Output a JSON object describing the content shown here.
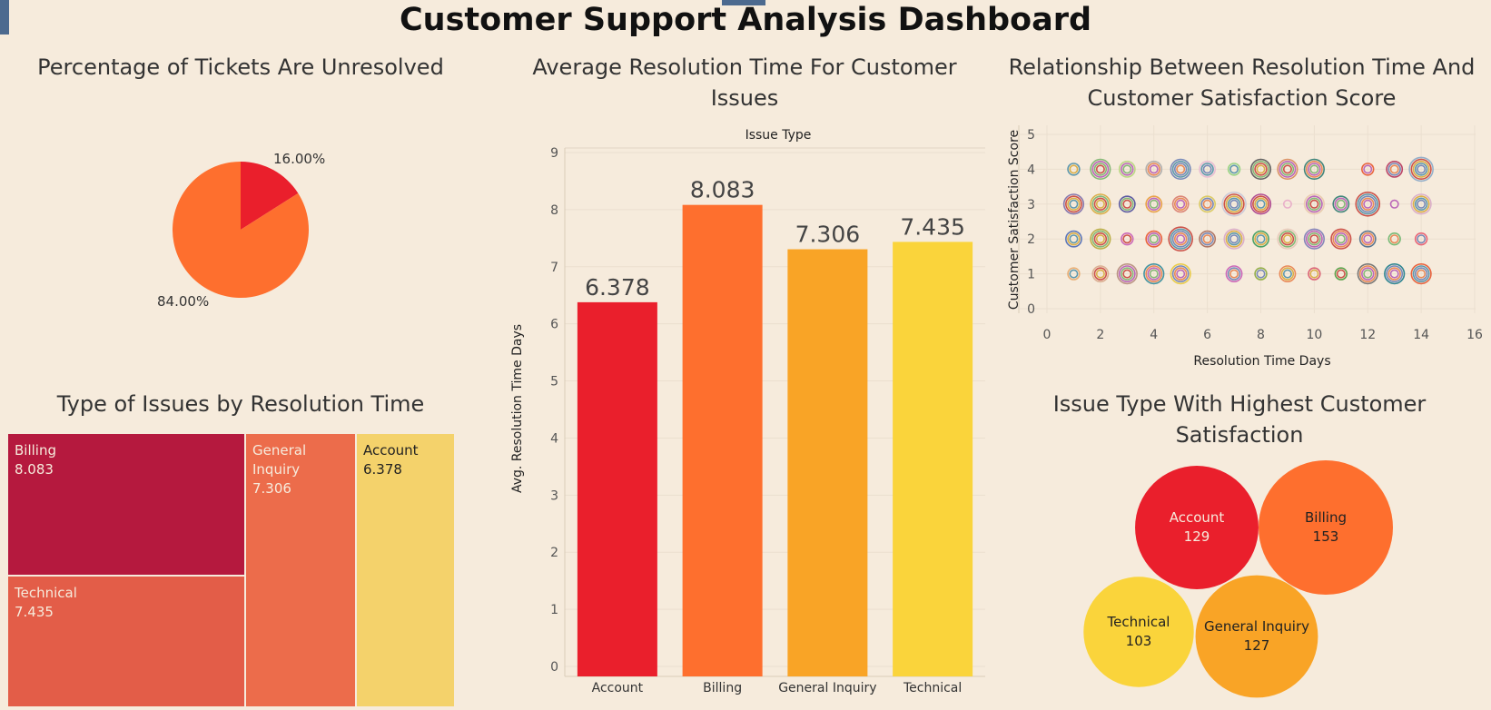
{
  "dashboard": {
    "title": "Customer Support Analysis Dashboard"
  },
  "colors": {
    "background": "#f6ebdc",
    "red": "#ea1f2c",
    "orange": "#fe6f2e",
    "amber": "#f9a426",
    "yellow": "#fad43b",
    "treemap_billing": "#b5193e",
    "treemap_technical": "#e35d48",
    "treemap_general": "#ec6c4b",
    "treemap_account": "#f4d26b"
  },
  "chart_data": [
    {
      "id": "pie",
      "type": "pie",
      "title": "Percentage of Tickets Are Unresolved",
      "slices": [
        {
          "label": "16.00%",
          "value": 16.0,
          "color": "#ea1f2c"
        },
        {
          "label": "84.00%",
          "value": 84.0,
          "color": "#fe6f2e"
        }
      ]
    },
    {
      "id": "bar",
      "type": "bar",
      "title": "Average Resolution Time For Customer Issues",
      "header": "Issue Type",
      "categories": [
        "Account",
        "Billing",
        "General Inquiry",
        "Technical"
      ],
      "values": [
        6.378,
        8.083,
        7.306,
        7.435
      ],
      "value_labels": [
        "6.378",
        "8.083",
        "7.306",
        "7.435"
      ],
      "colors": [
        "#ea1f2c",
        "#fe6f2e",
        "#f9a426",
        "#fad43b"
      ],
      "ylabel": "Avg. Resolution Time Days",
      "yticks": [
        "0",
        "1",
        "2",
        "3",
        "4",
        "5",
        "6",
        "7",
        "8",
        "9"
      ],
      "ylim": [
        0,
        9.15
      ]
    },
    {
      "id": "scatter",
      "type": "scatter",
      "title": "Relationship Between Resolution Time And Customer Satisfaction Score",
      "xlabel": "Resolution Time Days",
      "ylabel": "Customer Satisfaction Score",
      "xticks": [
        "0",
        "2",
        "4",
        "6",
        "8",
        "10",
        "12",
        "14",
        "16"
      ],
      "yticks": [
        "0",
        "1",
        "2",
        "3",
        "4",
        "5"
      ],
      "xlim": [
        0,
        16
      ],
      "ylim": [
        0,
        5.2
      ],
      "grid": true,
      "points": [
        [
          1,
          4,
          "#4e8fa8",
          2
        ],
        [
          2,
          4,
          "#7ab36b",
          4
        ],
        [
          3,
          4,
          "#b5d67a",
          3
        ],
        [
          4,
          4,
          "#a9a9a9",
          3
        ],
        [
          5,
          4,
          "#6a7fb5",
          4
        ],
        [
          6,
          4,
          "#e8b8d2",
          3
        ],
        [
          7,
          4,
          "#8fd17a",
          2
        ],
        [
          8,
          4,
          "#555555",
          4
        ],
        [
          9,
          4,
          "#d88a5a",
          4
        ],
        [
          10,
          4,
          "#2d7a70",
          4
        ],
        [
          12,
          4,
          "#e8552e",
          2
        ],
        [
          13,
          4,
          "#b5325a",
          3
        ],
        [
          14,
          4,
          "#8aa8c8",
          5
        ],
        [
          1,
          3,
          "#7a6aa8",
          4
        ],
        [
          2,
          3,
          "#d8a838",
          4
        ],
        [
          3,
          3,
          "#4b4b9a",
          3
        ],
        [
          4,
          3,
          "#e89a38",
          3
        ],
        [
          5,
          3,
          "#d87a6a",
          3
        ],
        [
          6,
          3,
          "#d8c858",
          3
        ],
        [
          7,
          3,
          "#c8c8d8",
          5
        ],
        [
          8,
          3,
          "#a83a8a",
          4
        ],
        [
          9,
          3,
          "#e8a8c8",
          1
        ],
        [
          10,
          3,
          "#e8c8a8",
          4
        ],
        [
          11,
          3,
          "#2d7a70",
          3
        ],
        [
          12,
          3,
          "#c8423a",
          5
        ],
        [
          13,
          3,
          "#b55ab5",
          1
        ],
        [
          14,
          3,
          "#d8a8c8",
          4
        ],
        [
          1,
          2,
          "#4b6ab5",
          3
        ],
        [
          2,
          2,
          "#b5a838",
          4
        ],
        [
          3,
          2,
          "#c85ab5",
          2
        ],
        [
          4,
          2,
          "#e8552e",
          3
        ],
        [
          5,
          2,
          "#c8423a",
          5
        ],
        [
          6,
          2,
          "#a86a5a",
          3
        ],
        [
          7,
          2,
          "#d8a8c8",
          4
        ],
        [
          8,
          2,
          "#3a9a5a",
          3
        ],
        [
          9,
          2,
          "#e8c8b8",
          4
        ],
        [
          10,
          2,
          "#7a7ab5",
          4
        ],
        [
          11,
          2,
          "#c8423a",
          4
        ],
        [
          12,
          2,
          "#4b6a8a",
          3
        ],
        [
          13,
          2,
          "#6ab56a",
          2
        ],
        [
          14,
          2,
          "#e8556a",
          2
        ],
        [
          1,
          1,
          "#e8a86a",
          2
        ],
        [
          2,
          1,
          "#d8a88a",
          3
        ],
        [
          3,
          1,
          "#b58a7a",
          4
        ],
        [
          4,
          1,
          "#2d8a9a",
          4
        ],
        [
          5,
          1,
          "#e8c838",
          4
        ],
        [
          7,
          1,
          "#c85ab5",
          3
        ],
        [
          8,
          1,
          "#8aa83a",
          2
        ],
        [
          9,
          1,
          "#e8804a",
          3
        ],
        [
          10,
          1,
          "#d8556a",
          2
        ],
        [
          11,
          1,
          "#4b9a3a",
          2
        ],
        [
          12,
          1,
          "#6a6a6a",
          4
        ],
        [
          13,
          1,
          "#1a7a8a",
          4
        ],
        [
          14,
          1,
          "#e8552e",
          4
        ]
      ]
    },
    {
      "id": "treemap",
      "type": "treemap",
      "title": "Type of Issues by Resolution Time",
      "items": [
        {
          "label": "Billing",
          "value": "8.083"
        },
        {
          "label": "Technical",
          "value": "7.435"
        },
        {
          "label": "General Inquiry",
          "value": "7.306"
        },
        {
          "label": "Account",
          "value": "6.378"
        }
      ]
    },
    {
      "id": "bubbles",
      "type": "bubble",
      "title": "Issue Type With Highest Customer Satisfaction",
      "items": [
        {
          "label": "Account",
          "value": 129,
          "value_label": "129",
          "color": "#ea1f2c",
          "text": "#f6ebdc"
        },
        {
          "label": "Billing",
          "value": 153,
          "value_label": "153",
          "color": "#fe6f2e",
          "text": "#222222"
        },
        {
          "label": "Technical",
          "value": 103,
          "value_label": "103",
          "color": "#fad43b",
          "text": "#222222"
        },
        {
          "label": "General Inquiry",
          "value": 127,
          "value_label": "127",
          "color": "#f9a426",
          "text": "#222222"
        }
      ]
    }
  ]
}
